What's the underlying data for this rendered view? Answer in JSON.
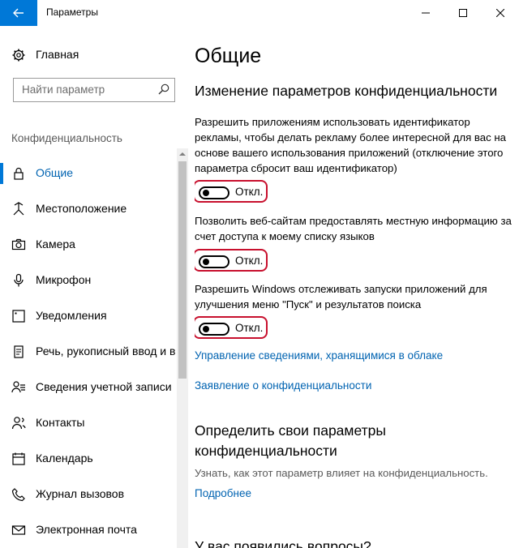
{
  "window": {
    "title": "Параметры"
  },
  "sidebar": {
    "home_label": "Главная",
    "search_placeholder": "Найти параметр",
    "section_title": "Конфиденциальность",
    "items": [
      {
        "label": "Общие",
        "icon": "lock-icon",
        "active": true
      },
      {
        "label": "Местоположение",
        "icon": "location-icon"
      },
      {
        "label": "Камера",
        "icon": "camera-icon"
      },
      {
        "label": "Микрофон",
        "icon": "microphone-icon"
      },
      {
        "label": "Уведомления",
        "icon": "notifications-icon"
      },
      {
        "label": "Речь, рукописный ввод и в",
        "icon": "speech-icon"
      },
      {
        "label": "Сведения учетной записи",
        "icon": "account-info-icon"
      },
      {
        "label": "Контакты",
        "icon": "contacts-icon"
      },
      {
        "label": "Календарь",
        "icon": "calendar-icon"
      },
      {
        "label": "Журнал вызовов",
        "icon": "call-history-icon"
      },
      {
        "label": "Электронная почта",
        "icon": "mail-icon"
      }
    ]
  },
  "main": {
    "title": "Общие",
    "section_title": "Изменение параметров конфиденциальности",
    "settings": [
      {
        "description": "Разрешить приложениям использовать идентификатор рекламы, чтобы делать рекламу более интересной для вас на основе вашего использования приложений (отключение этого параметра сбросит ваш идентификатор)",
        "state": "Откл."
      },
      {
        "description": "Позволить веб-сайтам предоставлять местную информацию за счет доступа к моему списку языков",
        "state": "Откл."
      },
      {
        "description": "Разрешить Windows отслеживать запуски приложений для улучшения меню \"Пуск\" и результатов поиска",
        "state": "Откл."
      }
    ],
    "link_cloud": "Управление сведениями, хранящимися в облаке",
    "link_statement": "Заявление о конфиденциальности",
    "section2_title": "Определить свои параметры конфиденциальности",
    "section2_hint": "Узнать, как этот параметр влияет на конфиденциальность.",
    "section2_link": "Подробнее",
    "section3_title": "У вас появились вопросы?"
  },
  "colors": {
    "accent": "#0078d7",
    "link": "#0063b1",
    "highlight": "#c8102e"
  }
}
